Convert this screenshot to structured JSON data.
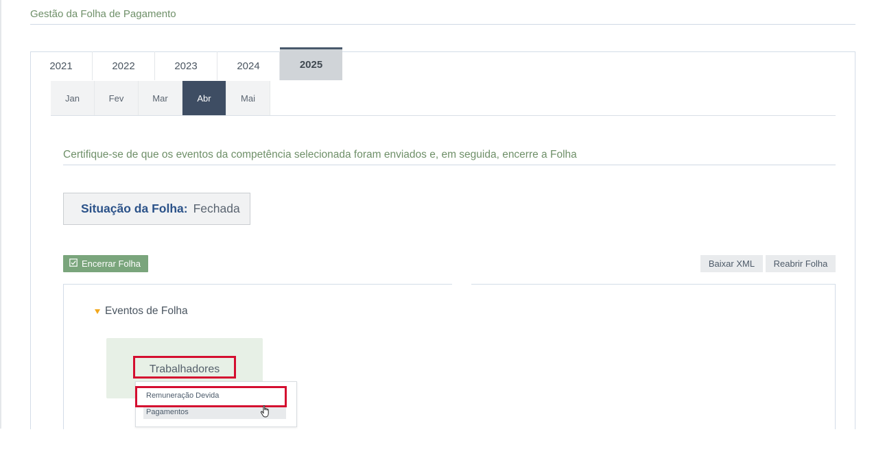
{
  "page": {
    "title": "Gestão da Folha de Pagamento"
  },
  "years": [
    "2021",
    "2022",
    "2023",
    "2024",
    "2025"
  ],
  "selected_year": "2025",
  "months": [
    "Jan",
    "Fev",
    "Mar",
    "Abr",
    "Mai"
  ],
  "selected_month": "Abr",
  "instruction": "Certifique-se de que os eventos da competência selecionada foram enviados e, em seguida, encerre a Folha",
  "status": {
    "label": "Situação da Folha:",
    "value": "Fechada"
  },
  "actions": {
    "close": "Encerrar Folha",
    "download_xml": "Baixar XML",
    "reopen": "Reabrir Folha"
  },
  "events": {
    "title": "Eventos de Folha",
    "card_label": "Trabalhadores",
    "menu": [
      "Remuneração Devida",
      "Pagamentos"
    ]
  },
  "colors": {
    "accent_green": "#7aa57c",
    "nav_dark": "#3e4d63",
    "highlight_red": "#d40d2f",
    "caret_orange": "#f2a81d"
  },
  "icons": {
    "close_button": "checkbox-icon",
    "events_toggle": "caret-down-icon",
    "pointer": "hand-cursor-icon"
  }
}
